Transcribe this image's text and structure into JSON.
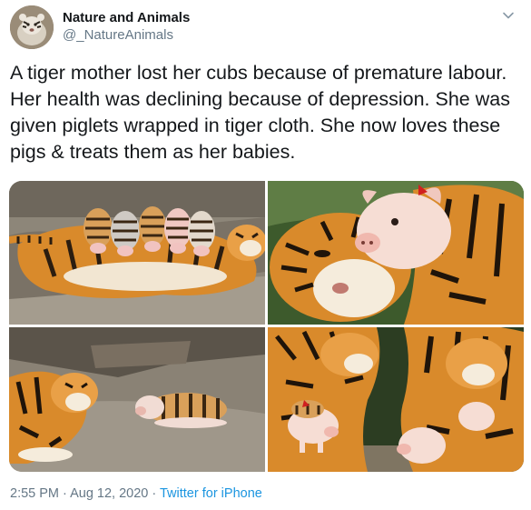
{
  "author": {
    "display_name": "Nature and Animals",
    "handle": "@_NatureAnimals",
    "avatar_icon": "tiger-avatar"
  },
  "menu_icon": "chevron-down-icon",
  "tweet": {
    "text": "A tiger mother lost her cubs because of premature labour. Her health was declining because of depression. She was given piglets wrapped in tiger cloth. She now loves these pigs & treats them as her babies."
  },
  "media": {
    "count": 4,
    "photos": [
      "tiger-nursing-piglets-photo",
      "tiger-and-pig-cuddling-photo",
      "tiger-and-piglet-resting-photo",
      "piglets-with-tigers-photo"
    ]
  },
  "meta": {
    "time": "2:55 PM",
    "separator": " · ",
    "date": "Aug 12, 2020",
    "source": "Twitter for iPhone"
  },
  "colors": {
    "text": "#14171a",
    "secondary": "#657786",
    "link": "#1b95e0",
    "tiger_orange": "#d98a2b"
  }
}
